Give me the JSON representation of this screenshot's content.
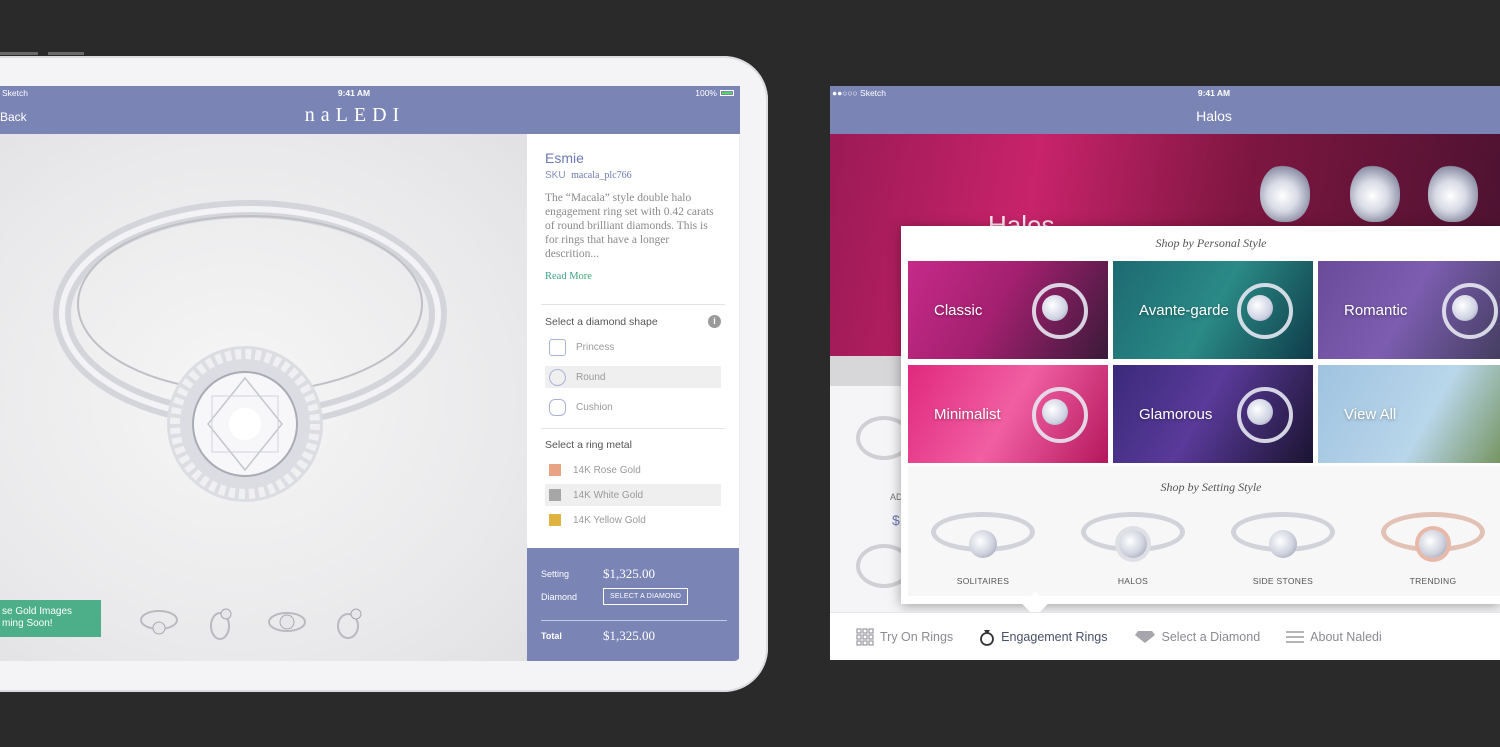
{
  "left": {
    "status": {
      "carrier": "Sketch",
      "time": "9:41 AM",
      "battery": "100%"
    },
    "nav": {
      "back": "Back",
      "brand": "naLEDI"
    },
    "banner": {
      "line1": "se Gold Images",
      "line2": "ming Soon!"
    },
    "product": {
      "name": "Esmie",
      "sku_label": "SKU",
      "sku_value": "macala_plc766",
      "description": "The “Macala” style double halo engagement ring set with 0.42 carats of round brilliant diamonds. This is for rings that have a longer descrition...",
      "read_more": "Read More"
    },
    "shape": {
      "title": "Select a diamond shape",
      "options": [
        {
          "label": "Princess"
        },
        {
          "label": "Round"
        },
        {
          "label": "Cushion"
        }
      ]
    },
    "metal": {
      "title": "Select a ring metal",
      "options": [
        {
          "label": "14K Rose Gold",
          "color": "#e8a384"
        },
        {
          "label": "14K White Gold",
          "color": "#a6a6a6"
        },
        {
          "label": "14K Yellow Gold",
          "color": "#e0b23f"
        }
      ]
    },
    "price": {
      "setting_label": "Setting",
      "setting_value": "$1,325.00",
      "diamond_label": "Diamond",
      "diamond_button": "SELECT A DIAMOND",
      "total_label": "Total",
      "total_value": "$1,325.00"
    }
  },
  "right": {
    "status": {
      "carrier": "●●○○○ Sketch",
      "time": "9:41 AM"
    },
    "nav": {
      "title": "Halos"
    },
    "hero": {
      "text": "Halos"
    },
    "background": {
      "label": "AD",
      "price": "$"
    },
    "popover": {
      "personal_heading": "Shop by Personal Style",
      "tiles": [
        {
          "label": "Classic",
          "bg": "linear-gradient(120deg,#c62a8a 0%,#a3206f 45%,#3a1a3a 100%)"
        },
        {
          "label": "Avante-garde",
          "bg": "linear-gradient(120deg,#1d6a72 0%,#2a8a86 50%,#0f3c4a 100%)"
        },
        {
          "label": "Romantic",
          "bg": "linear-gradient(120deg,#6a4b9a 0%,#7c5db0 45%,#3c3a55 100%)"
        },
        {
          "label": "Minimalist",
          "bg": "linear-gradient(120deg,#e0287e 0%,#f15fa2 50%,#b4175c 100%)"
        },
        {
          "label": "Glamorous",
          "bg": "linear-gradient(120deg,#3a2a7a 0%,#5a3a9a 45%,#1a1430 100%)"
        },
        {
          "label": "View All",
          "bg": "linear-gradient(120deg,#9fc3e0 0%,#b9d6ea 55%,#6a8a4a 100%)"
        }
      ],
      "setting_heading": "Shop by Setting Style",
      "settings": [
        {
          "label": "SOLITAIRES",
          "stone": "plain"
        },
        {
          "label": "HALOS",
          "stone": "halo"
        },
        {
          "label": "SIDE STONES",
          "stone": "plain"
        },
        {
          "label": "TRENDING",
          "stone": "rose"
        }
      ]
    },
    "tabs": [
      {
        "label": "Try On Rings",
        "icon": "grid-icon"
      },
      {
        "label": "Engagement Rings",
        "icon": "ring-icon"
      },
      {
        "label": "Select a Diamond",
        "icon": "diamond-icon"
      },
      {
        "label": "About Naledi",
        "icon": "menu-icon"
      }
    ]
  }
}
